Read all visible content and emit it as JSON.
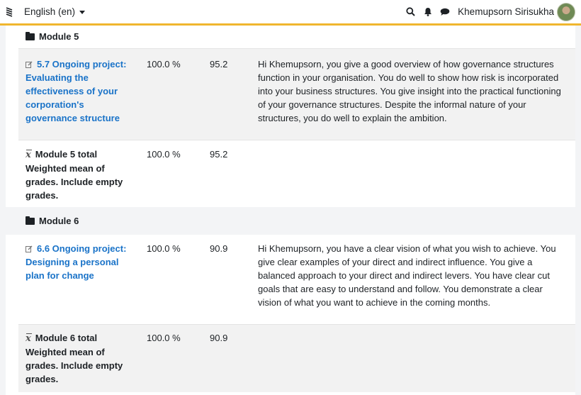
{
  "navbar": {
    "language": "English (en)",
    "user_name": "Khemupsorn Sirisukha",
    "icons": [
      "search-icon",
      "bell-icon",
      "chat-icon"
    ]
  },
  "sections": [
    {
      "category": "Module 5",
      "item": {
        "name": "5.7 Ongoing project: Evaluating the effectiveness of your corporation's governance structure",
        "percentage": "100.0 %",
        "grade": "95.2",
        "feedback": "Hi Khemupsorn, you give a good overview of how governance structures function in your organisation. You do well to show how risk is incorporated into your business structures. You give insight into the practical functioning of your governance structures. Despite the informal nature of your structures, you do well to explain the ambition."
      },
      "total": {
        "name": "Module 5 total",
        "subtitle": "Weighted mean of grades. Include empty grades.",
        "percentage": "100.0 %",
        "grade": "95.2"
      }
    },
    {
      "category": "Module 6",
      "item": {
        "name": "6.6 Ongoing project: Designing a personal plan for change",
        "percentage": "100.0 %",
        "grade": "90.9",
        "feedback": "Hi Khemupsorn, you have a clear vision of what you wish to achieve. You give clear examples of your direct and indirect influence. You give a balanced approach to your direct and indirect levers. You have clear cut goals that are easy to understand and follow. You demonstrate a clear vision of what you want to achieve in the coming months."
      },
      "total": {
        "name": "Module 6 total",
        "subtitle": "Weighted mean of grades. Include empty grades.",
        "percentage": "100.0 %",
        "grade": "90.9"
      }
    }
  ],
  "colors": {
    "accent_bar": "#f0b62e",
    "link": "#1a73c8",
    "row_shade": "#f2f2f2"
  }
}
